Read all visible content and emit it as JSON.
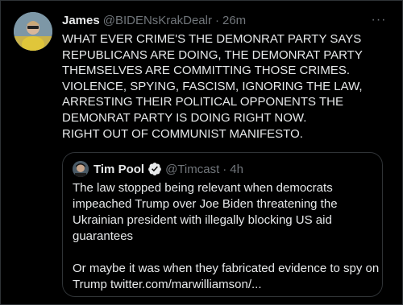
{
  "tweet": {
    "author_name": "James",
    "author_handle": "@BIDENsKrakDealr",
    "separator": "·",
    "timestamp": "26m",
    "more_label": "···",
    "lines": [
      "WHAT EVER CRIME'S THE DEMONRAT PARTY SAYS",
      "REPUBLICANS ARE DOING, THE DEMONRAT PARTY",
      "THEMSELVES ARE COMMITTING THOSE CRIMES.",
      "VIOLENCE, SPYING, FASCISM, IGNORING THE LAW,",
      "ARRESTING THEIR POLITICAL OPPONENTS THE",
      "DEMONRAT PARTY IS DOING RIGHT NOW.",
      "RIGHT OUT OF COMMUNIST MANIFESTO."
    ]
  },
  "quote": {
    "author_name": "Tim Pool",
    "author_handle": "@Timcast",
    "separator": "·",
    "timestamp": "4h",
    "verified_icon": "verified-badge-icon",
    "lines_p1": [
      "The law stopped being relevant when democrats",
      "impeached Trump over Joe Biden threatening the",
      "Ukrainian president with illegally blocking US aid",
      "guarantees"
    ],
    "lines_p2": [
      "Or maybe it was when they fabricated evidence to spy on",
      "Trump twitter.com/marwilliamson/..."
    ]
  },
  "colors": {
    "background": "#000000",
    "text": "#e7e9ea",
    "muted": "#71767b",
    "border": "#2f3336"
  }
}
